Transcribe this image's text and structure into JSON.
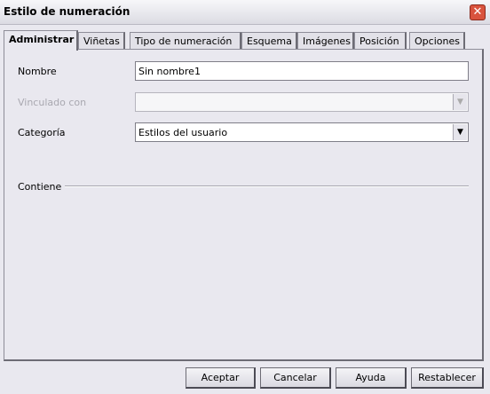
{
  "window": {
    "title": "Estilo de numeración"
  },
  "tabs": [
    {
      "label": "Administrar"
    },
    {
      "label": "Viñetas"
    },
    {
      "label": "Tipo de numeración"
    },
    {
      "label": "Esquema"
    },
    {
      "label": "Imágenes"
    },
    {
      "label": "Posición"
    },
    {
      "label": "Opciones"
    }
  ],
  "form": {
    "nombre_label": "Nombre",
    "nombre_value": "Sin nombre1",
    "vinculado_label": "Vinculado con",
    "vinculado_value": "",
    "categoria_label": "Categoría",
    "categoria_value": "Estilos del usuario",
    "contiene_label": "Contiene"
  },
  "buttons": {
    "accept": "Aceptar",
    "cancel": "Cancelar",
    "help": "Ayuda",
    "reset": "Restablecer"
  }
}
